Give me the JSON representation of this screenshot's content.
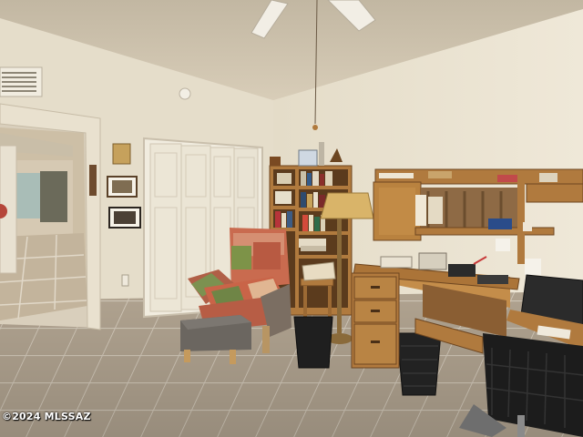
{
  "image": {
    "kind": "interior photo",
    "watermark": "©2024 MLSSAZ"
  },
  "colors": {
    "wall": "#e7dfcd",
    "ceiling": "#cdc2ad",
    "floor_tile": "#b7a995",
    "wood": "#b27a3e",
    "dark_wood": "#7a4a22",
    "door": "#ece6d6",
    "ottoman": "#6b6660",
    "quilt_red": "#b85a42",
    "quilt_green": "#7a8f4a",
    "trash": "#1e1e1e"
  }
}
